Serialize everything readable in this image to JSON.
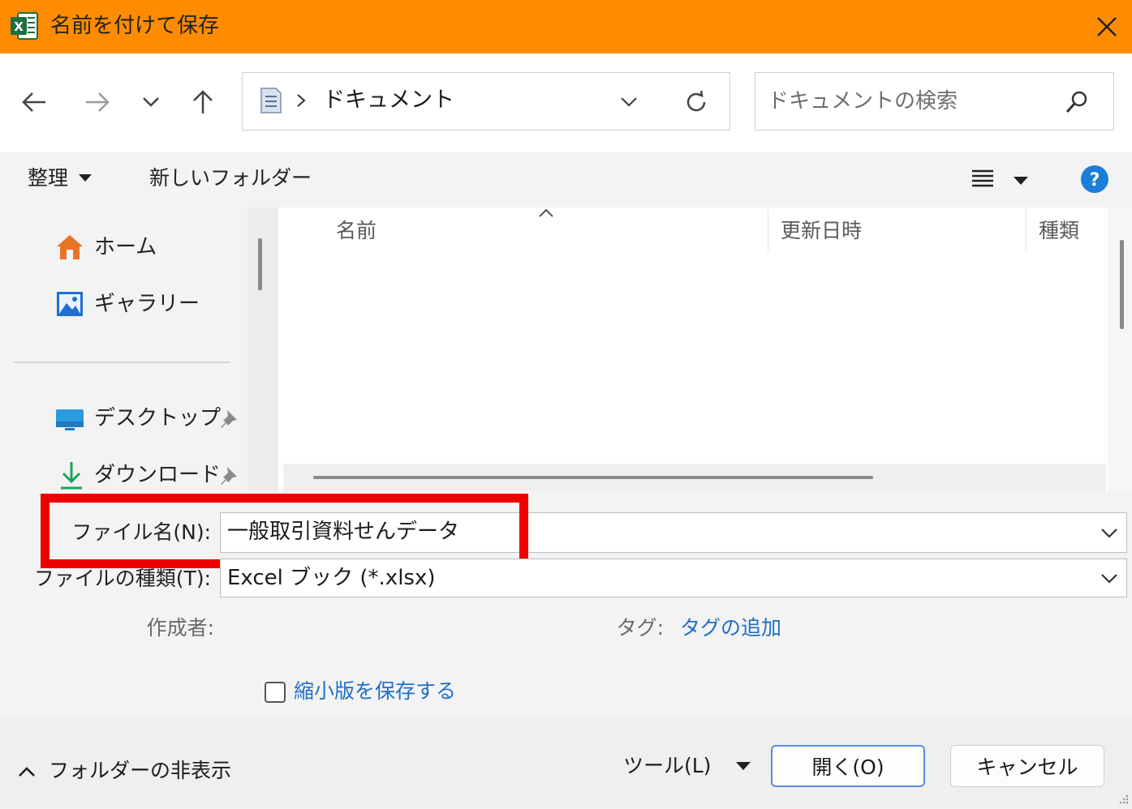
{
  "window": {
    "title": "名前を付けて保存",
    "app_icon": "excel-icon",
    "accent_color": "#ff8c00"
  },
  "nav": {
    "breadcrumb_current": "ドキュメント",
    "search_placeholder": "ドキュメントの検索"
  },
  "toolbar": {
    "organize_label": "整理",
    "new_folder_label": "新しいフォルダー"
  },
  "sidebar": {
    "items": [
      {
        "label": "ホーム",
        "icon": "home-icon"
      },
      {
        "label": "ギャラリー",
        "icon": "gallery-icon"
      },
      {
        "label": "デスクトップ",
        "icon": "desktop-icon",
        "pinned": true
      },
      {
        "label": "ダウンロード",
        "icon": "download-icon",
        "pinned": true
      }
    ]
  },
  "filelist": {
    "columns": [
      "名前",
      "更新日時",
      "種類"
    ]
  },
  "form": {
    "filename_label": "ファイル名(N):",
    "filename_value": "一般取引資料せんデータ",
    "filetype_label": "ファイルの種類(T):",
    "filetype_value": "Excel ブック (*.xlsx)",
    "author_label": "作成者:",
    "tags_label": "タグ:",
    "tags_add_label": "タグの追加",
    "thumbnail_label": "縮小版を保存する"
  },
  "footer": {
    "hide_folders_label": "フォルダーの非表示",
    "tools_label": "ツール(L)",
    "open_label": "開く(O)",
    "cancel_label": "キャンセル"
  }
}
